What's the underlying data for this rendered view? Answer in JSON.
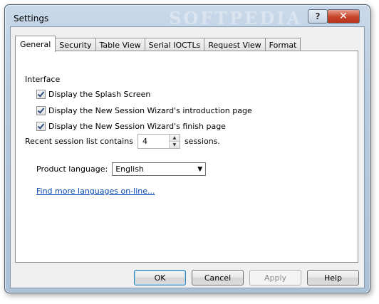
{
  "window": {
    "title": "Settings",
    "watermark": "SOFTPEDIA",
    "help_glyph": "?",
    "close_glyph": "✕"
  },
  "tabs": [
    {
      "label": "General",
      "active": true
    },
    {
      "label": "Security",
      "active": false
    },
    {
      "label": "Table View",
      "active": false
    },
    {
      "label": "Serial IOCTLs",
      "active": false
    },
    {
      "label": "Request View",
      "active": false
    },
    {
      "label": "Format",
      "active": false
    }
  ],
  "general": {
    "interface_label": "Interface",
    "checkboxes": [
      {
        "label": "Display the Splash Screen",
        "checked": true
      },
      {
        "label": "Display the New Session Wizard's introduction page",
        "checked": true
      },
      {
        "label": "Display the New Session Wizard's finish page",
        "checked": true
      }
    ],
    "recent_prefix": "Recent session list contains",
    "recent_value": "4",
    "recent_suffix": "sessions.",
    "product_language_label": "Product language:",
    "product_language_value": "English",
    "find_languages_link": "Find more languages on-line..."
  },
  "buttons": {
    "ok": "OK",
    "cancel": "Cancel",
    "apply": "Apply",
    "help": "Help"
  }
}
